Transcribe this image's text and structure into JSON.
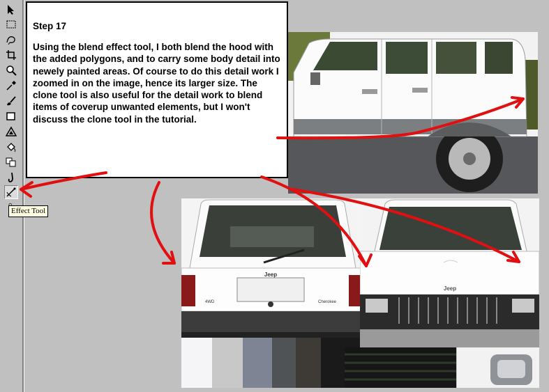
{
  "toolbox": {
    "tools": [
      {
        "name": "pointer-tool-icon",
        "glyph": "arrow"
      },
      {
        "name": "selection-tool-icon",
        "glyph": "marquee"
      },
      {
        "name": "lasso-tool-icon",
        "glyph": "lasso"
      },
      {
        "name": "crop-tool-icon",
        "glyph": "crop"
      },
      {
        "name": "zoom-tool-icon",
        "glyph": "zoom"
      },
      {
        "name": "eyedropper-tool-icon",
        "glyph": "dropper"
      },
      {
        "name": "paint-brush-tool-icon",
        "glyph": "brush"
      },
      {
        "name": "shape-tool-icon",
        "glyph": "rect"
      },
      {
        "name": "polygon-tool-icon",
        "glyph": "triangle"
      },
      {
        "name": "fill-tool-icon",
        "glyph": "bucket"
      },
      {
        "name": "clone-tool-icon",
        "glyph": "clone"
      },
      {
        "name": "smudge-tool-icon",
        "glyph": "finger"
      },
      {
        "name": "effect-tool-icon",
        "glyph": "effect"
      },
      {
        "name": "extra-tool-icon",
        "glyph": "small"
      }
    ],
    "active_tool": "effect-tool-icon",
    "tooltip": "Effect Tool"
  },
  "step": {
    "title": "Step 17",
    "text": "Using the blend effect tool, I both blend the hood with the added polygons, and to carry some body detail into newely painted areas. Of course to do this detail work I zoomed in on the image, hence its  larger size.  The clone tool is also useful for the detail work to blend items of coverup unwanted elements, but I won't discuss the clone tool in the tutorial."
  },
  "photos": {
    "rear_badge": "Jeep",
    "rear_left_label": "4WD",
    "rear_right_label": "Cherokee",
    "front_badge": "Jeep"
  },
  "colors": {
    "arrow": "#e01010",
    "panel_border": "#000000",
    "toolbox_bg": "#c0c0c0"
  }
}
